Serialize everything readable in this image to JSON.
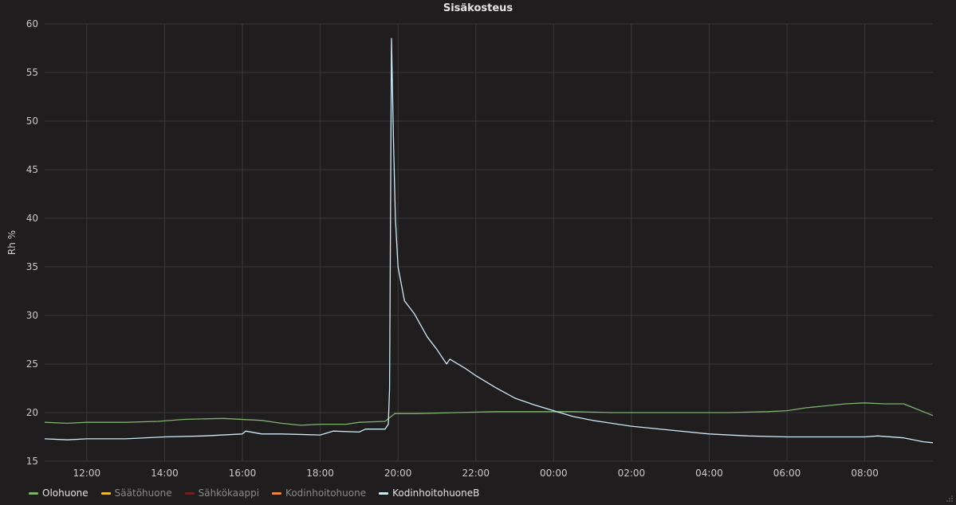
{
  "panel": {
    "title": "Sisäkosteus"
  },
  "chart_data": {
    "type": "line",
    "title": "Sisäkosteus",
    "xlabel": "",
    "ylabel": "Rh %",
    "ylim": [
      15,
      60
    ],
    "y_ticks": [
      15,
      20,
      25,
      30,
      35,
      40,
      45,
      50,
      55,
      60
    ],
    "x_unit": "hours from 12:00 (day 1)",
    "x_range": [
      "10:55",
      "09:45"
    ],
    "x_ticks": [
      "12:00",
      "14:00",
      "16:00",
      "18:00",
      "20:00",
      "22:00",
      "00:00",
      "02:00",
      "04:00",
      "06:00",
      "08:00"
    ],
    "grid": true,
    "legend_position": "bottom-left",
    "series": [
      {
        "name": "Olohuone",
        "color": "#7eb26d",
        "visible": true,
        "points": [
          [
            "10:55",
            19.0
          ],
          [
            "11:30",
            18.9
          ],
          [
            "12:00",
            19.0
          ],
          [
            "13:00",
            19.0
          ],
          [
            "13:50",
            19.1
          ],
          [
            "14:30",
            19.3
          ],
          [
            "15:30",
            19.4
          ],
          [
            "16:30",
            19.2
          ],
          [
            "17:00",
            18.9
          ],
          [
            "17:30",
            18.7
          ],
          [
            "18:00",
            18.8
          ],
          [
            "18:40",
            18.8
          ],
          [
            "19:00",
            19.0
          ],
          [
            "19:40",
            19.1
          ],
          [
            "19:55",
            19.9
          ],
          [
            "20:30",
            19.9
          ],
          [
            "21:30",
            20.0
          ],
          [
            "22:30",
            20.1
          ],
          [
            "23:30",
            20.1
          ],
          [
            "00:30",
            20.1
          ],
          [
            "01:30",
            20.0
          ],
          [
            "02:30",
            20.0
          ],
          [
            "03:30",
            20.0
          ],
          [
            "04:30",
            20.0
          ],
          [
            "05:30",
            20.1
          ],
          [
            "06:00",
            20.2
          ],
          [
            "06:30",
            20.5
          ],
          [
            "07:00",
            20.7
          ],
          [
            "07:30",
            20.9
          ],
          [
            "08:00",
            21.0
          ],
          [
            "08:30",
            20.9
          ],
          [
            "09:00",
            20.9
          ],
          [
            "09:15",
            20.5
          ],
          [
            "09:45",
            19.7
          ]
        ]
      },
      {
        "name": "Säätöhuone",
        "color": "#eab839",
        "visible": false,
        "points": []
      },
      {
        "name": "Sähkökaappi",
        "color": "#6d1f1f",
        "visible": false,
        "points": []
      },
      {
        "name": "Kodinhoitohuone",
        "color": "#ef843c",
        "visible": false,
        "points": []
      },
      {
        "name": "KodinhoitohuoneB",
        "color": "#cfeaf7",
        "visible": true,
        "points": [
          [
            "10:55",
            17.3
          ],
          [
            "11:30",
            17.2
          ],
          [
            "12:00",
            17.3
          ],
          [
            "13:00",
            17.3
          ],
          [
            "14:00",
            17.5
          ],
          [
            "15:00",
            17.6
          ],
          [
            "16:00",
            17.8
          ],
          [
            "16:05",
            18.1
          ],
          [
            "16:30",
            17.8
          ],
          [
            "17:00",
            17.8
          ],
          [
            "18:00",
            17.7
          ],
          [
            "18:20",
            18.1
          ],
          [
            "19:00",
            18.0
          ],
          [
            "19:10",
            18.3
          ],
          [
            "19:40",
            18.3
          ],
          [
            "19:45",
            18.8
          ],
          [
            "19:47",
            22.5
          ],
          [
            "19:50",
            58.5
          ],
          [
            "19:53",
            48.0
          ],
          [
            "19:56",
            40.0
          ],
          [
            "20:00",
            35.0
          ],
          [
            "20:10",
            31.5
          ],
          [
            "20:25",
            30.2
          ],
          [
            "20:45",
            27.8
          ],
          [
            "21:00",
            26.5
          ],
          [
            "21:15",
            25.0
          ],
          [
            "21:20",
            25.5
          ],
          [
            "21:45",
            24.5
          ],
          [
            "22:00",
            23.8
          ],
          [
            "22:30",
            22.6
          ],
          [
            "23:00",
            21.5
          ],
          [
            "23:30",
            20.8
          ],
          [
            "00:00",
            20.2
          ],
          [
            "00:30",
            19.6
          ],
          [
            "01:00",
            19.2
          ],
          [
            "02:00",
            18.6
          ],
          [
            "03:00",
            18.2
          ],
          [
            "04:00",
            17.8
          ],
          [
            "05:00",
            17.6
          ],
          [
            "06:00",
            17.5
          ],
          [
            "07:00",
            17.5
          ],
          [
            "08:00",
            17.5
          ],
          [
            "08:20",
            17.6
          ],
          [
            "09:00",
            17.4
          ],
          [
            "09:30",
            17.0
          ],
          [
            "09:45",
            16.9
          ]
        ]
      }
    ]
  }
}
